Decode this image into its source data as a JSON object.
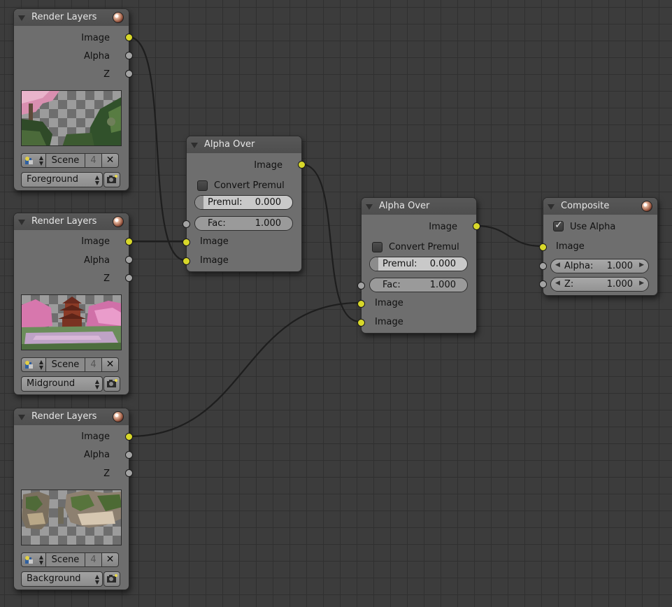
{
  "colors": {
    "editor_background": "#3c3c3c",
    "node_body": "#6e6e6e",
    "node_header": "#545454",
    "image_socket": "#d8d82a",
    "value_socket": "#a3a3a3",
    "wire": "#1e1e1e"
  },
  "icons": {
    "collapse": "triangle-down-icon",
    "preview": "material-sphere-icon",
    "scene_browse": "scene-data-icon",
    "unlink": "x-close-icon",
    "render_layer": "render-camera-icon"
  },
  "render_layers": [
    {
      "title": "Render Layers",
      "outputs": [
        "Image",
        "Alpha",
        "Z"
      ],
      "scene": "Scene",
      "scene_users": "4",
      "layer": "Foreground"
    },
    {
      "title": "Render Layers",
      "outputs": [
        "Image",
        "Alpha",
        "Z"
      ],
      "scene": "Scene",
      "scene_users": "4",
      "layer": "Midground"
    },
    {
      "title": "Render Layers",
      "outputs": [
        "Image",
        "Alpha",
        "Z"
      ],
      "scene": "Scene",
      "scene_users": "4",
      "layer": "Background"
    }
  ],
  "alpha_over": [
    {
      "title": "Alpha Over",
      "output": "Image",
      "convert_premul_label": "Convert Premul",
      "convert_premul_checked": false,
      "premul_label": "Premul:",
      "premul_value": "0.000",
      "fac_label": "Fac:",
      "fac_value": "1.000",
      "inputs": [
        "Image",
        "Image"
      ]
    },
    {
      "title": "Alpha Over",
      "output": "Image",
      "convert_premul_label": "Convert Premul",
      "convert_premul_checked": false,
      "premul_label": "Premul:",
      "premul_value": "0.000",
      "fac_label": "Fac:",
      "fac_value": "1.000",
      "inputs": [
        "Image",
        "Image"
      ]
    }
  ],
  "composite": {
    "title": "Composite",
    "use_alpha_label": "Use Alpha",
    "use_alpha_checked": true,
    "input": "Image",
    "alpha_label": "Alpha:",
    "alpha_value": "1.000",
    "z_label": "Z:",
    "z_value": "1.000"
  }
}
